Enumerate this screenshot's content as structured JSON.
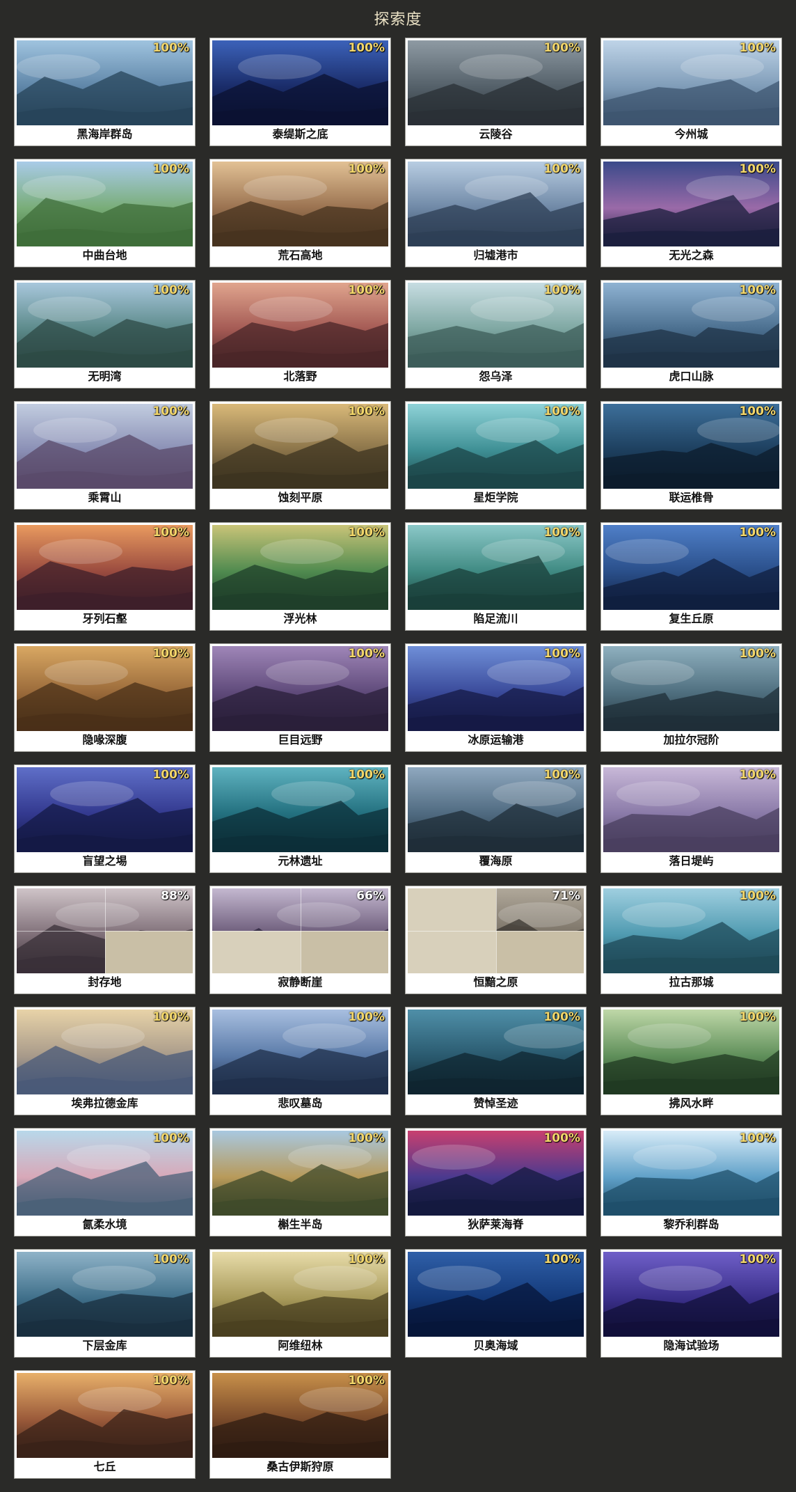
{
  "page": {
    "title": "探索度"
  },
  "colors": {
    "background": "#2a2a28",
    "title_text": "#ece3c6",
    "percent_complete": "#f2d66a",
    "percent_partial": "#ffffff",
    "card_background": "#ffffff"
  },
  "regions": [
    {
      "name": "黑海岸群岛",
      "percent": "100%",
      "scene": [
        "#9fc3df",
        "#5f86a8",
        "#27445a"
      ]
    },
    {
      "name": "泰缇斯之底",
      "percent": "100%",
      "scene": [
        "#3c62b9",
        "#1a2c69",
        "#0b1232"
      ]
    },
    {
      "name": "云陵谷",
      "percent": "100%",
      "scene": [
        "#8e9aa3",
        "#546069",
        "#2a3036"
      ]
    },
    {
      "name": "今州城",
      "percent": "100%",
      "scene": [
        "#bfd4e8",
        "#7f9cb8",
        "#3e5570"
      ]
    },
    {
      "name": "中曲台地",
      "percent": "100%",
      "scene": [
        "#a9cbe8",
        "#79ad78",
        "#3f6e3a"
      ]
    },
    {
      "name": "荒石高地",
      "percent": "100%",
      "scene": [
        "#e2c195",
        "#9a7250",
        "#47331f"
      ]
    },
    {
      "name": "归墟港市",
      "percent": "100%",
      "scene": [
        "#b8cde2",
        "#6f88a6",
        "#2e3f55"
      ]
    },
    {
      "name": "无光之森",
      "percent": "100%",
      "scene": [
        "#3b4a8a",
        "#9a6aa8",
        "#1c1f3e"
      ]
    },
    {
      "name": "无明湾",
      "percent": "100%",
      "scene": [
        "#a8c7dc",
        "#5c8a8a",
        "#2d4a45"
      ]
    },
    {
      "name": "北落野",
      "percent": "100%",
      "scene": [
        "#e0a58e",
        "#a45a54",
        "#4a2628"
      ]
    },
    {
      "name": "怨乌泽",
      "percent": "100%",
      "scene": [
        "#c7dde2",
        "#7ea7a2",
        "#3d5d5a"
      ]
    },
    {
      "name": "虎口山脉",
      "percent": "100%",
      "scene": [
        "#8fb3d3",
        "#4b6f8f",
        "#1f3347"
      ]
    },
    {
      "name": "乘霄山",
      "percent": "100%",
      "scene": [
        "#c2cde0",
        "#8a8fb5",
        "#5a4a6a"
      ]
    },
    {
      "name": "蚀刻平原",
      "percent": "100%",
      "scene": [
        "#d9b979",
        "#8a7349",
        "#3d3420"
      ]
    },
    {
      "name": "星炬学院",
      "percent": "100%",
      "scene": [
        "#8fd3d8",
        "#3e8f94",
        "#1c4548"
      ]
    },
    {
      "name": "联运椎骨",
      "percent": "100%",
      "scene": [
        "#3d6f9a",
        "#1d3f5e",
        "#0c1c2c"
      ]
    },
    {
      "name": "牙列石壑",
      "percent": "100%",
      "scene": [
        "#e99a5f",
        "#9a4b3f",
        "#3e1f2a"
      ]
    },
    {
      "name": "浮光林",
      "percent": "100%",
      "scene": [
        "#c9c478",
        "#4f8a4f",
        "#1f3f2a"
      ]
    },
    {
      "name": "陷足流川",
      "percent": "100%",
      "scene": [
        "#8bc8c8",
        "#3f8a82",
        "#1a3f3a"
      ]
    },
    {
      "name": "复生丘原",
      "percent": "100%",
      "scene": [
        "#4f7fc8",
        "#2a4f8a",
        "#101f3f"
      ]
    },
    {
      "name": "隐喙深腹",
      "percent": "100%",
      "scene": [
        "#d9a863",
        "#9a6a3a",
        "#4a3018"
      ]
    },
    {
      "name": "巨目远野",
      "percent": "100%",
      "scene": [
        "#9f86b8",
        "#5f4a7a",
        "#2a1f3a"
      ]
    },
    {
      "name": "冰原运输港",
      "percent": "100%",
      "scene": [
        "#6f8fd8",
        "#3a4a9a",
        "#151a45"
      ]
    },
    {
      "name": "加拉尔冠阶",
      "percent": "100%",
      "scene": [
        "#8fb0bf",
        "#4f6f7f",
        "#1f2f38"
      ]
    },
    {
      "name": "盲望之埸",
      "percent": "100%",
      "scene": [
        "#5f6fc8",
        "#33398f",
        "#141a45"
      ]
    },
    {
      "name": "元林遗址",
      "percent": "100%",
      "scene": [
        "#5fb3c0",
        "#23707f",
        "#0c2f38"
      ]
    },
    {
      "name": "覆海原",
      "percent": "100%",
      "scene": [
        "#8fa8bf",
        "#4f6a80",
        "#1f2d38"
      ]
    },
    {
      "name": "落日堤屿",
      "percent": "100%",
      "scene": [
        "#c8b8d8",
        "#8a7aa8",
        "#4a3f5f"
      ]
    },
    {
      "name": "封存地",
      "percent": "88%",
      "scene": [
        "#cfc4c8",
        "#7f6f78",
        "#3a3038"
      ],
      "fog": [
        3
      ]
    },
    {
      "name": "寂静断崖",
      "percent": "66%",
      "scene": [
        "#c4b8d0",
        "#6a5a78",
        "#2a2238"
      ],
      "fog": [
        2,
        3
      ]
    },
    {
      "name": "恒黯之原",
      "percent": "71%",
      "scene": [
        "#b0a89a",
        "#7a7266",
        "#3a3630"
      ],
      "fog": [
        0,
        2,
        3
      ]
    },
    {
      "name": "拉古那城",
      "percent": "100%",
      "scene": [
        "#9fcfe0",
        "#4f9ab0",
        "#1f4a58"
      ]
    },
    {
      "name": "埃弗拉德金库",
      "percent": "100%",
      "scene": [
        "#e8d3a8",
        "#a89a8a",
        "#4a5a78"
      ]
    },
    {
      "name": "悲叹墓岛",
      "percent": "100%",
      "scene": [
        "#a8bfe0",
        "#5a7aa8",
        "#1f2f4a"
      ]
    },
    {
      "name": "赞悼圣迹",
      "percent": "100%",
      "scene": [
        "#4f8fa8",
        "#2a5a6f",
        "#0f2530"
      ]
    },
    {
      "name": "拂风水畔",
      "percent": "100%",
      "scene": [
        "#bfd8a8",
        "#5f8f5a",
        "#203a22"
      ]
    },
    {
      "name": "氤柔水境",
      "percent": "100%",
      "scene": [
        "#b8d8ea",
        "#d8a8b8",
        "#4a6078"
      ]
    },
    {
      "name": "槲生半岛",
      "percent": "100%",
      "scene": [
        "#a8c8e0",
        "#b89a5a",
        "#3f4a2a"
      ]
    },
    {
      "name": "狄萨莱海脊",
      "percent": "100%",
      "scene": [
        "#c83f6f",
        "#4a3a8f",
        "#141a3f"
      ]
    },
    {
      "name": "黎乔利群岛",
      "percent": "100%",
      "scene": [
        "#d8ecf8",
        "#5fa0c8",
        "#1f4f6a"
      ]
    },
    {
      "name": "下层金库",
      "percent": "100%",
      "scene": [
        "#8fb3c8",
        "#3f6f8a",
        "#1a2f3f"
      ]
    },
    {
      "name": "阿维纽林",
      "percent": "100%",
      "scene": [
        "#e8dcaa",
        "#a89a5a",
        "#4a4020"
      ]
    },
    {
      "name": "贝奥海域",
      "percent": "100%",
      "scene": [
        "#2f5fa8",
        "#143a7a",
        "#07163a"
      ]
    },
    {
      "name": "隐海试验场",
      "percent": "100%",
      "scene": [
        "#6f5fc8",
        "#3a2f8a",
        "#12103a"
      ]
    },
    {
      "name": "七丘",
      "percent": "100%",
      "scene": [
        "#e8b06a",
        "#9a5a3a",
        "#3a2218"
      ]
    },
    {
      "name": "桑古伊斯狩原",
      "percent": "100%",
      "scene": [
        "#c8904a",
        "#7a4a2a",
        "#2f1c12"
      ]
    }
  ]
}
